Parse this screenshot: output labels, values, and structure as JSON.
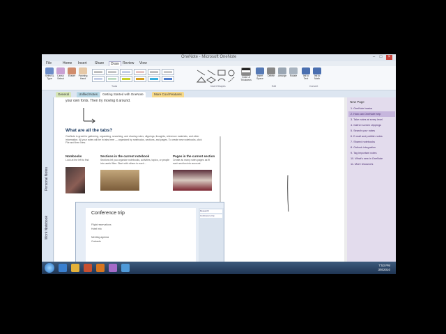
{
  "window": {
    "title": "OneNote - Microsoft OneNote"
  },
  "menu": {
    "items": [
      "File",
      "Home",
      "Insert",
      "Share",
      "Draw",
      "Review",
      "View"
    ],
    "active_index": 4
  },
  "ribbon": {
    "buttons": [
      {
        "label": "Select & Type",
        "icon": "cursor-icon",
        "color": "#6b8cc7"
      },
      {
        "label": "Lasso Select",
        "icon": "lasso-icon",
        "color": "#c9a0d3"
      },
      {
        "label": "Eraser",
        "icon": "eraser-icon",
        "color": "#d08c6c"
      },
      {
        "label": "Panning Hand",
        "icon": "hand-icon",
        "color": "#e6c9a8"
      }
    ],
    "pens": [
      "#222222",
      "#333333",
      "#3355aa",
      "#aa3333",
      "#222222",
      "#444444",
      "#3355aa",
      "#228833",
      "#c9d22b",
      "#d6a020",
      "#3ab0e0",
      "#5080d0"
    ],
    "right_buttons": [
      {
        "label": "Color & Thickness",
        "icon": "color-thickness-icon"
      },
      {
        "label": "Insert Space",
        "icon": "insert-space-icon"
      },
      {
        "label": "Delete",
        "icon": "delete-icon"
      },
      {
        "label": "Arrange",
        "icon": "arrange-icon"
      },
      {
        "label": "Rotate",
        "icon": "rotate-icon"
      },
      {
        "label": "Ink to Text",
        "icon": "ink-to-text-icon"
      },
      {
        "label": "Ink to Math",
        "icon": "ink-to-math-icon"
      }
    ],
    "groups": [
      "Tools",
      "Insert Shapes",
      "Edit",
      "Convert"
    ]
  },
  "section_tabs": [
    {
      "label": "General",
      "color": "#d7e6b8"
    },
    {
      "label": "Unfiled Notes",
      "color": "#b8d8e6"
    },
    {
      "label": "Getting Started with OneNote",
      "color": "#ffffff"
    },
    {
      "label": "More Cool Features",
      "color": "#f6d98a"
    }
  ],
  "nav_pane": {
    "labels": [
      "Personal Notes",
      "Work Notebook"
    ]
  },
  "page": {
    "intro_text": "your own fonts. Then try moving it around.",
    "heading": "What are all the tabs?",
    "body": "OneNote is great for gathering, organizing, searching, and sharing notes, clippings, thoughts, reference materials, and other information. All your notes will be in tabs here — organized by notebooks, sections, and pages. To create new notebooks, click File and then New.",
    "columns": [
      {
        "title": "Notebooks",
        "text": "Look at the left to find"
      },
      {
        "title": "Sections in the current notebook",
        "text": "Sections let you organize notebooks, activities, topics, or people into useful files. Start with others to each..."
      },
      {
        "title": "Pages in the current section",
        "text": "Create as many notes pages as fit each section into account"
      }
    ],
    "embedded": {
      "title": "Conference trip",
      "lines": [
        "Flight reservations",
        "Hotel info",
        "Meeting agenda",
        "Contacts"
      ],
      "section_labels": [
        "Research",
        "Conference trip"
      ]
    }
  },
  "page_list": {
    "new_page_label": "New Page",
    "items": [
      "1. OneNote basics",
      "2. How can OneNote help",
      "3. Take notes at every level",
      "4. Gather screen clippings",
      "5. Search your notes",
      "6. E-mail and publish notes",
      "7. Shared notebooks",
      "8. Outlook integration",
      "9. Tag important notes",
      "10. What's new in OneNote",
      "11. More resources"
    ],
    "selected_index": 1
  },
  "taskbar": {
    "icons": [
      {
        "name": "internet-explorer-icon",
        "color": "#3a80d0"
      },
      {
        "name": "explorer-icon",
        "color": "#e4b13a"
      },
      {
        "name": "media-player-icon",
        "color": "#c84f2f"
      },
      {
        "name": "firefox-icon",
        "color": "#d8761f"
      },
      {
        "name": "onenote-icon",
        "color": "#a56bc8"
      },
      {
        "name": "network-icon",
        "color": "#4f9ad9"
      }
    ],
    "time": "7:53 PM",
    "date": "3/8/2010"
  }
}
